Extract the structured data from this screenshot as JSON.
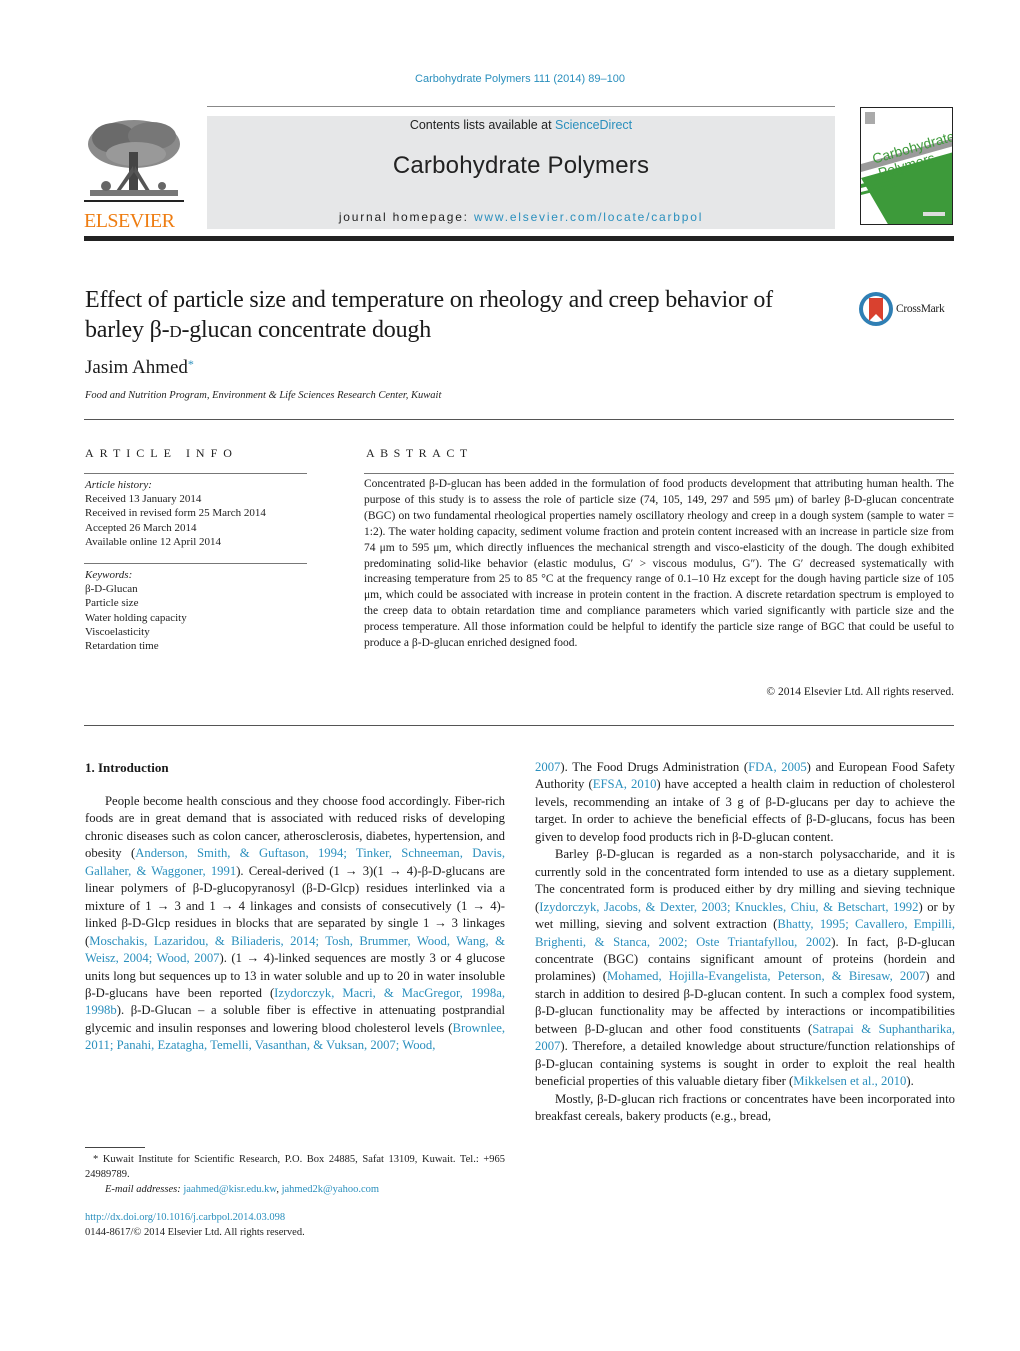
{
  "header": {
    "citation": "Carbohydrate Polymers 111 (2014) 89–100",
    "contents_prefix": "Contents lists available at ",
    "contents_link": "ScienceDirect",
    "journal_name": "Carbohydrate Polymers",
    "homepage_prefix": "journal homepage: ",
    "homepage_link": "www.elsevier.com/locate/carbpol",
    "publisher_logo_text": "ELSEVIER",
    "cover_title_line1": "Carbohydrate",
    "cover_title_line2": "Polymers",
    "crossmark_label": "CrossMark",
    "colors": {
      "link": "#2a8fbd",
      "elsevier_orange": "#ee7d12",
      "cover_green": "#3d9a3a",
      "masthead_gray": "#e6e7e8",
      "crossmark_red": "#d9412f"
    }
  },
  "article": {
    "title_part1": "Effect of particle size and temperature on rheology and creep behavior of barley β-",
    "title_sc": "d",
    "title_part2": "-glucan concentrate dough",
    "author": "Jasim Ahmed",
    "author_mark": "*",
    "affiliation": "Food and Nutrition Program, Environment & Life Sciences Research Center, Kuwait"
  },
  "article_info": {
    "heading": "ARTICLE INFO",
    "history_label": "Article history:",
    "history": [
      "Received 13 January 2014",
      "Received in revised form 25 March 2014",
      "Accepted 26 March 2014",
      "Available online 12 April 2014"
    ],
    "keywords_label": "Keywords:",
    "keywords": [
      "β-D-Glucan",
      "Particle size",
      "Water holding capacity",
      "Viscoelasticity",
      "Retardation time"
    ]
  },
  "abstract": {
    "heading": "ABSTRACT",
    "text": "Concentrated β-D-glucan has been added in the formulation of food products development that attributing human health. The purpose of this study is to assess the role of particle size (74, 105, 149, 297 and 595 μm) of barley β-D-glucan concentrate (BGC) on two fundamental rheological properties namely oscillatory rheology and creep in a dough system (sample to water = 1:2). The water holding capacity, sediment volume fraction and protein content increased with an increase in particle size from 74 μm to 595 μm, which directly influences the mechanical strength and visco-elasticity of the dough. The dough exhibited predominating solid-like behavior (elastic modulus, G′ > viscous modulus, G″). The G′ decreased systematically with increasing temperature from 25 to 85 °C at the frequency range of 0.1–10 Hz except for the dough having particle size of 105 μm, which could be associated with increase in protein content in the fraction. A discrete retardation spectrum is employed to the creep data to obtain retardation time and compliance parameters which varied significantly with particle size and the process temperature. All those information could be helpful to identify the particle size range of BGC that could be useful to produce a β-D-glucan enriched designed food.",
    "copyright": "© 2014 Elsevier Ltd. All rights reserved."
  },
  "body": {
    "section_heading": "1.  Introduction",
    "left_column": [
      [
        {
          "t": "People become health conscious and they choose food accordingly. Fiber-rich foods are in great demand that is associated with reduced risks of developing chronic diseases such as colon cancer, atherosclerosis, diabetes, hypertension, and obesity ("
        },
        {
          "l": "Anderson, Smith, & Guftason, 1994; Tinker, Schneeman, Davis, Gallaher, & Waggoner, 1991"
        },
        {
          "t": "). Cereal-derived (1 → 3)(1 → 4)-β-D-glucans are linear polymers of β-D-glucopyranosyl (β-D-Glcp) residues interlinked via a mixture of 1 → 3 and 1 → 4 linkages and consists of consecutively (1 → 4)-linked β-D-Glcp residues in blocks that are separated by single 1 → 3 linkages ("
        },
        {
          "l": "Moschakis, Lazaridou, & Biliaderis, 2014; Tosh, Brummer, Wood, Wang, & Weisz, 2004; Wood, 2007"
        },
        {
          "t": "). (1 → 4)-linked sequences are mostly 3 or 4 glucose units long but sequences up to 13 in water soluble and up to 20 in water insoluble β-D-glucans have been reported ("
        },
        {
          "l": "Izydorczyk, Macri, & MacGregor, 1998a, 1998b"
        },
        {
          "t": "). β-D-Glucan – a soluble fiber is effective in attenuating postprandial glycemic and insulin responses and lowering blood cholesterol levels ("
        },
        {
          "l": "Brownlee, 2011; Panahi, Ezatagha, Temelli, Vasanthan, & Vuksan, 2007; Wood,"
        }
      ]
    ],
    "right_column": [
      [
        {
          "l": "2007"
        },
        {
          "t": "). The Food Drugs Administration ("
        },
        {
          "l": "FDA, 2005"
        },
        {
          "t": ") and European Food Safety Authority ("
        },
        {
          "l": "EFSA, 2010"
        },
        {
          "t": ") have accepted a health claim in reduction of cholesterol levels, recommending an intake of 3 g of β-D-glucans per day to achieve the target. In order to achieve the beneficial effects of β-D-glucans, focus has been given to develop food products rich in β-D-glucan content."
        }
      ],
      [
        {
          "t": "Barley β-D-glucan is regarded as a non-starch polysaccharide, and it is currently sold in the concentrated form intended to use as a dietary supplement. The concentrated form is produced either by dry milling and sieving technique ("
        },
        {
          "l": "Izydorczyk, Jacobs, & Dexter, 2003; Knuckles, Chiu, & Betschart, 1992"
        },
        {
          "t": ") or by wet milling, sieving and solvent extraction ("
        },
        {
          "l": "Bhatty, 1995; Cavallero, Empilli, Brighenti, & Stanca, 2002; Oste Triantafyllou, 2002"
        },
        {
          "t": "). In fact, β-D-glucan concentrate (BGC) contains significant amount of proteins (hordein and prolamines) ("
        },
        {
          "l": "Mohamed, Hojilla-Evangelista, Peterson, & Biresaw, 2007"
        },
        {
          "t": ") and starch in addition to desired β-D-glucan content. In such a complex food system, β-D-glucan functionality may be affected by interactions or incompatibilities between β-D-glucan and other food constituents ("
        },
        {
          "l": "Satrapai & Suphantharika, 2007"
        },
        {
          "t": "). Therefore, a detailed knowledge about structure/function relationships of β-D-glucan containing systems is sought in order to exploit the real health beneficial properties of this valuable dietary fiber ("
        },
        {
          "l": "Mikkelsen et al., 2010"
        },
        {
          "t": ")."
        }
      ],
      [
        {
          "t": "Mostly, β-D-glucan rich fractions or concentrates have been incorporated into breakfast cereals, bakery products (e.g., bread,"
        }
      ]
    ]
  },
  "footnote": {
    "mark": "*",
    "address": "Kuwait Institute for Scientific Research, P.O. Box 24885, Safat 13109, Kuwait. Tel.: +965 24989789.",
    "email_label": "E-mail addresses:",
    "email1": "jaahmed@kisr.edu.kw",
    "email_sep": ", ",
    "email2": "jahmed2k@yahoo.com",
    "doi": "http://dx.doi.org/10.1016/j.carbpol.2014.03.098",
    "issn_line": "0144-8617/© 2014 Elsevier Ltd. All rights reserved."
  }
}
